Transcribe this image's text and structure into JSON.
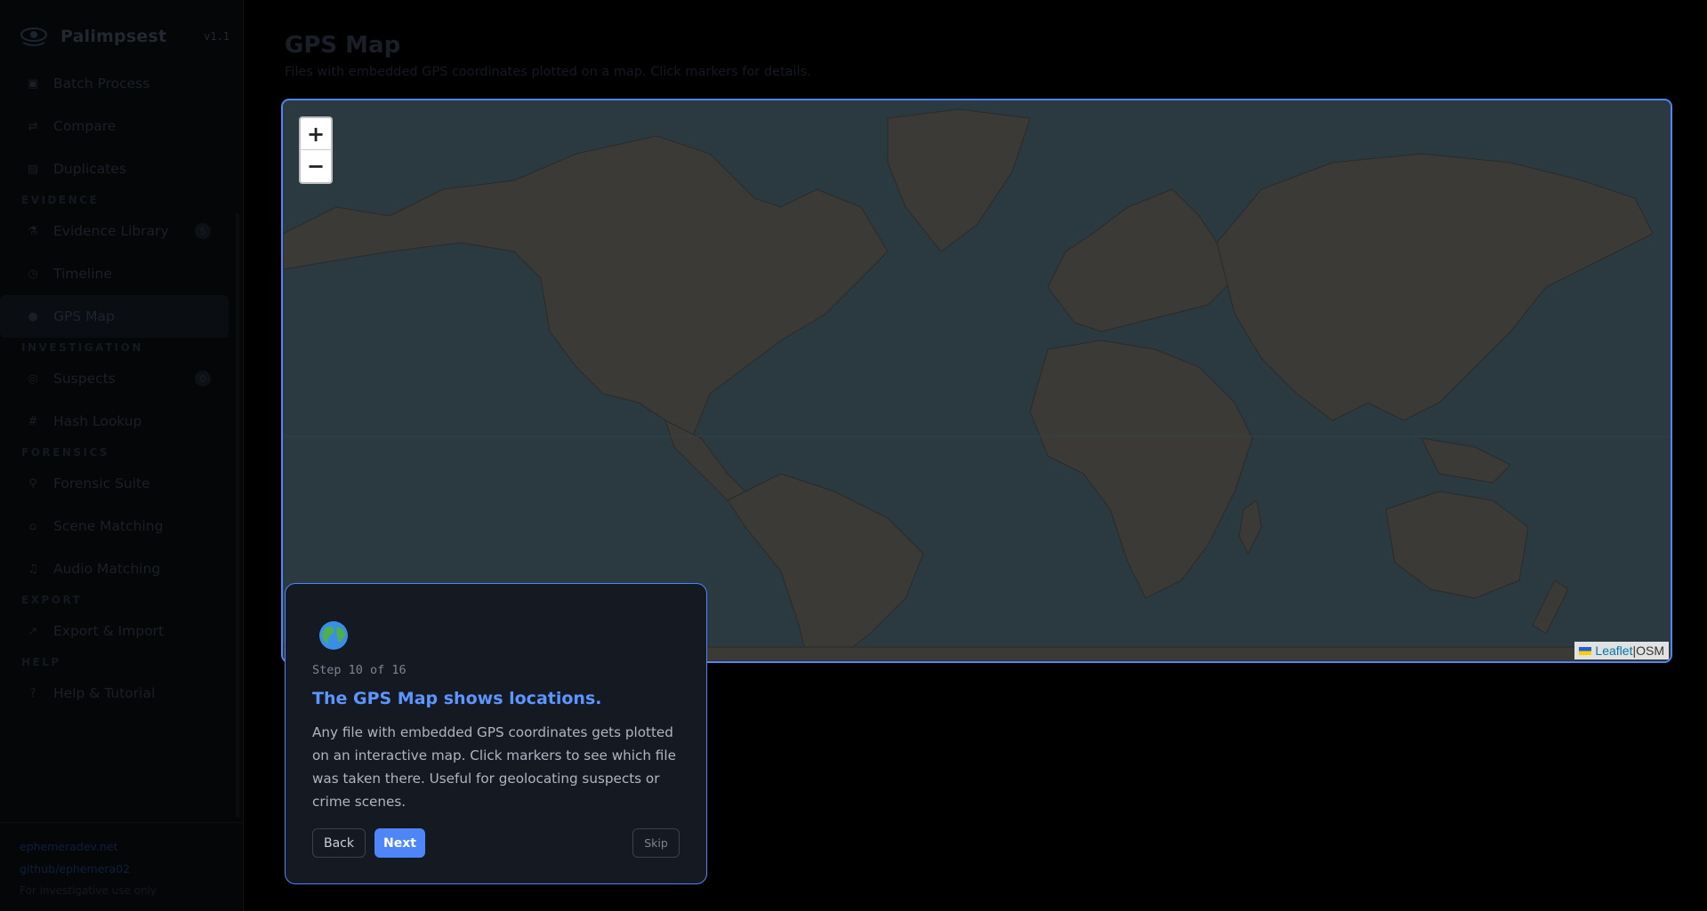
{
  "app": {
    "name": "Palimpsest",
    "version": "v1.1"
  },
  "sidebar": {
    "top_items": [
      {
        "label": "Batch Process",
        "icon": "box-icon"
      },
      {
        "label": "Compare",
        "icon": "swap-icon"
      },
      {
        "label": "Duplicates",
        "icon": "copy-icon"
      }
    ],
    "sections": [
      {
        "title": "EVIDENCE",
        "items": [
          {
            "label": "Evidence Library",
            "icon": "microscope-icon",
            "badge": "5"
          },
          {
            "label": "Timeline",
            "icon": "clock-icon"
          },
          {
            "label": "GPS Map",
            "icon": "globe-icon",
            "active": true
          }
        ]
      },
      {
        "title": "INVESTIGATION",
        "items": [
          {
            "label": "Suspects",
            "icon": "target-icon",
            "badge": "0"
          },
          {
            "label": "Hash Lookup",
            "icon": "hash-icon"
          }
        ]
      },
      {
        "title": "FORENSICS",
        "items": [
          {
            "label": "Forensic Suite",
            "icon": "flask-icon"
          },
          {
            "label": "Scene Matching",
            "icon": "house-icon"
          },
          {
            "label": "Audio Matching",
            "icon": "music-icon"
          }
        ]
      },
      {
        "title": "EXPORT",
        "items": [
          {
            "label": "Export & Import",
            "icon": "arrow-icon"
          }
        ]
      },
      {
        "title": "HELP",
        "items": [
          {
            "label": "Help & Tutorial",
            "icon": "question-icon"
          }
        ]
      }
    ],
    "footer": {
      "link1": "ephemeradev.net",
      "link2": "github/ephemera02",
      "note": "For investigative use only"
    }
  },
  "main": {
    "title": "GPS Map",
    "subtitle": "Files with embedded GPS coordinates plotted on a map. Click markers for details."
  },
  "map": {
    "zoom_in": "+",
    "zoom_out": "−",
    "attribution_link": "Leaflet",
    "attribution_sep": " | ",
    "attribution_osm": "OSM",
    "colors": {
      "ocean": "#2b3a40",
      "land": "#3b3a36",
      "border": "#4f86f7"
    }
  },
  "tour": {
    "step": "Step 10 of 16",
    "title": "The GPS Map shows locations.",
    "body": "Any file with embedded GPS coordinates gets plotted on an interactive map. Click markers to see which file was taken there. Useful for geolocating suspects or crime scenes.",
    "back": "Back",
    "next": "Next",
    "skip": "Skip"
  }
}
